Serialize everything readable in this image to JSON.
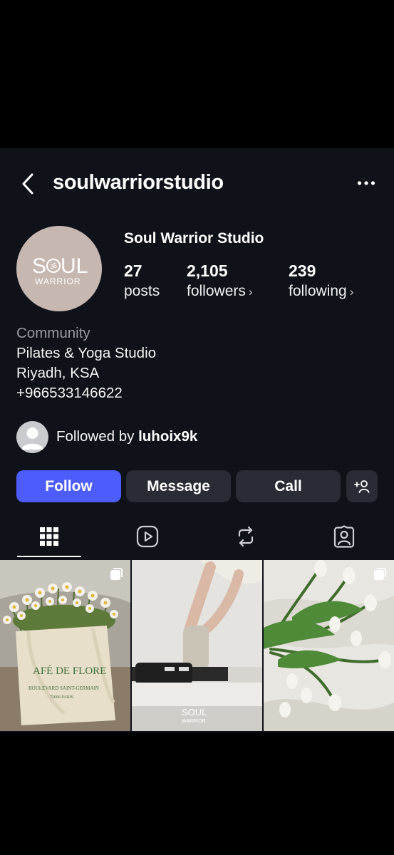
{
  "header": {
    "username": "soulwarriorstudio",
    "back_icon": "chevron-left-icon",
    "more_icon": "more-horizontal-icon"
  },
  "profile": {
    "display_name": "Soul Warrior Studio",
    "avatar_logo": {
      "top": "S",
      "middle_a": "UL",
      "bottom": "WARRIOR"
    },
    "stats": {
      "posts": {
        "value": "27",
        "label": "posts"
      },
      "followers": {
        "value": "2,105",
        "label": "followers",
        "chevron": "›"
      },
      "following": {
        "value": "239",
        "label": "following",
        "chevron": "›"
      }
    }
  },
  "bio": {
    "category": "Community",
    "lines": [
      "Pilates & Yoga Studio",
      "Riyadh, KSA",
      "+966533146622"
    ]
  },
  "followed_by": {
    "prefix": "Followed by ",
    "user": "luhoix9k"
  },
  "actions": {
    "follow": "Follow",
    "message": "Message",
    "call": "Call",
    "add_icon": "add-person-icon"
  },
  "tabs": [
    {
      "icon": "grid-icon",
      "active": true
    },
    {
      "icon": "reels-icon",
      "active": false
    },
    {
      "icon": "reposts-icon",
      "active": false
    },
    {
      "icon": "tagged-icon",
      "active": false
    }
  ],
  "posts": [
    {
      "subject": "daisies-in-tote-bag",
      "tote_text": [
        "AFÉ DE FLORE",
        "BOULEVARD SAINT-GERMAIN",
        "75006 PARIS"
      ],
      "multi": true
    },
    {
      "subject": "pilates-reformer",
      "watermark": {
        "top": "SOUL",
        "bottom": "WARRIOR"
      },
      "multi": false
    },
    {
      "subject": "white-tulips",
      "multi": true
    }
  ],
  "colors": {
    "background": "#10121a",
    "follow_button": "#4d5dfb",
    "secondary_button": "#2a2c35",
    "avatar_bg": "#c6b7b1"
  }
}
